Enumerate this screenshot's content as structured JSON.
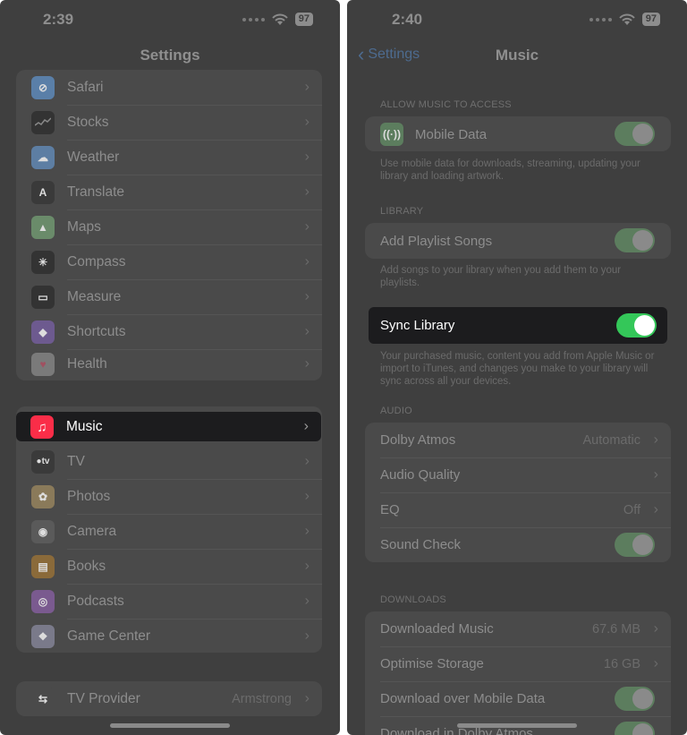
{
  "left": {
    "status": {
      "time": "2:39",
      "battery": "97"
    },
    "title": "Settings",
    "group1": [
      {
        "label": "Safari",
        "icon": "compass-icon",
        "color": "#5a7fa8"
      },
      {
        "label": "Stocks",
        "icon": "stocks-icon",
        "color": "#333333"
      },
      {
        "label": "Weather",
        "icon": "weather-icon",
        "color": "#5d7ea3"
      },
      {
        "label": "Translate",
        "icon": "translate-icon",
        "color": "#3a3a3a"
      },
      {
        "label": "Maps",
        "icon": "maps-icon",
        "color": "#6a8b6a"
      },
      {
        "label": "Compass",
        "icon": "compass-dial-icon",
        "color": "#333333"
      },
      {
        "label": "Measure",
        "icon": "ruler-icon",
        "color": "#333333"
      },
      {
        "label": "Shortcuts",
        "icon": "shortcuts-icon",
        "color": "#6d5a8f"
      },
      {
        "label": "Health",
        "icon": "heart-icon",
        "color": "#7a7a7a"
      }
    ],
    "music": {
      "label": "Music",
      "icon": "music-note-icon",
      "color": "#fa2d48"
    },
    "group2": [
      {
        "label": "TV",
        "icon": "tv-icon",
        "color": "#3a3a3a",
        "glyph": "●tv"
      },
      {
        "label": "Photos",
        "icon": "photos-icon",
        "color": "#8a7a5a"
      },
      {
        "label": "Camera",
        "icon": "camera-icon",
        "color": "#5a5a5a"
      },
      {
        "label": "Books",
        "icon": "book-icon",
        "color": "#8a6a3a"
      },
      {
        "label": "Podcasts",
        "icon": "podcast-icon",
        "color": "#7a5a8f"
      },
      {
        "label": "Game Center",
        "icon": "game-center-icon",
        "color": "#7a7a8a"
      }
    ],
    "group3": [
      {
        "label": "TV Provider",
        "value": "Armstrong",
        "icon": "tv-provider-icon",
        "color": "#4a4a4a"
      }
    ]
  },
  "right": {
    "status": {
      "time": "2:40",
      "battery": "97"
    },
    "back_label": "Settings",
    "title": "Music",
    "sections": {
      "allow": {
        "header": "ALLOW MUSIC TO ACCESS",
        "mobile_data": "Mobile Data",
        "footer": "Use mobile data for downloads, streaming, updating your library and loading artwork."
      },
      "library": {
        "header": "LIBRARY",
        "add_playlist": "Add Playlist Songs",
        "footer": "Add songs to your library when you add them to your playlists.",
        "sync_library": "Sync Library",
        "sync_footer": "Your purchased music, content you add from Apple Music or import to iTunes, and changes you make to your library will sync across all your devices."
      },
      "audio": {
        "header": "AUDIO",
        "dolby": "Dolby Atmos",
        "dolby_value": "Automatic",
        "quality": "Audio Quality",
        "eq": "EQ",
        "eq_value": "Off",
        "sound_check": "Sound Check"
      },
      "downloads": {
        "header": "DOWNLOADS",
        "downloaded": "Downloaded Music",
        "downloaded_value": "67.6 MB",
        "optimise": "Optimise Storage",
        "optimise_value": "16 GB",
        "over_mobile": "Download over Mobile Data",
        "dolby_dl": "Download in Dolby Atmos"
      }
    }
  }
}
